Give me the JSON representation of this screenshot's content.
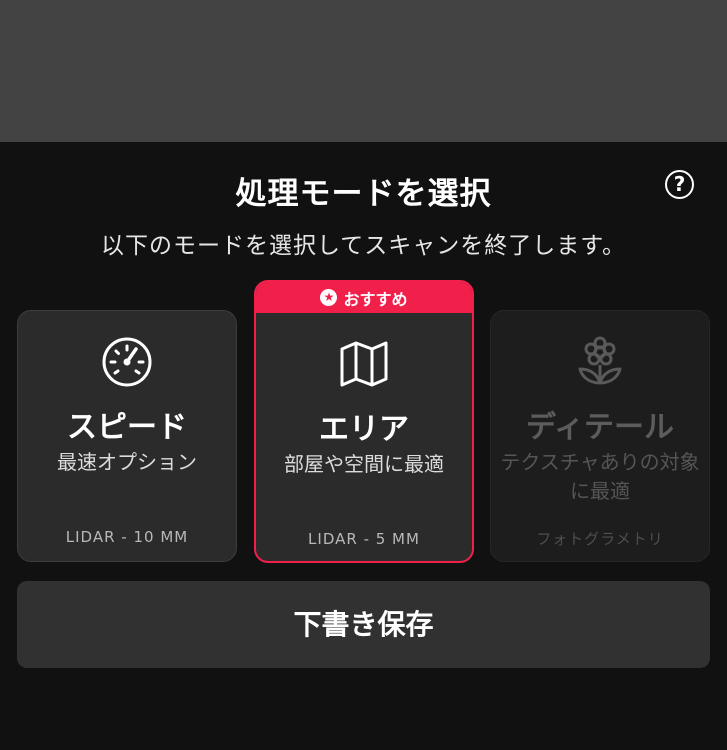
{
  "header": {
    "title": "処理モードを選択",
    "subtitle": "以下のモードを選択してスキャンを終了します。",
    "help_label": "?"
  },
  "modes": [
    {
      "title": "スピード",
      "description": "最速オプション",
      "footer": "LIDAR - 10 MM",
      "icon": "speedometer-icon",
      "enabled": true,
      "selected": false
    },
    {
      "badge": "おすすめ",
      "badge_icon": "star-icon",
      "title": "エリア",
      "description": "部屋や空間に最適",
      "footer": "LIDAR - 5 MM",
      "icon": "map-icon",
      "enabled": true,
      "selected": true
    },
    {
      "title": "ディテール",
      "description": "テクスチャありの対象に最適",
      "footer": "フォトグラメトリ",
      "icon": "flower-icon",
      "enabled": false,
      "selected": false
    }
  ],
  "actions": {
    "save_draft_label": "下書き保存"
  },
  "colors": {
    "accent": "#f0204b",
    "background": "#111111",
    "backdrop": "#434343",
    "card": "#2b2b2b",
    "disabled_text": "#5c5c5c"
  }
}
